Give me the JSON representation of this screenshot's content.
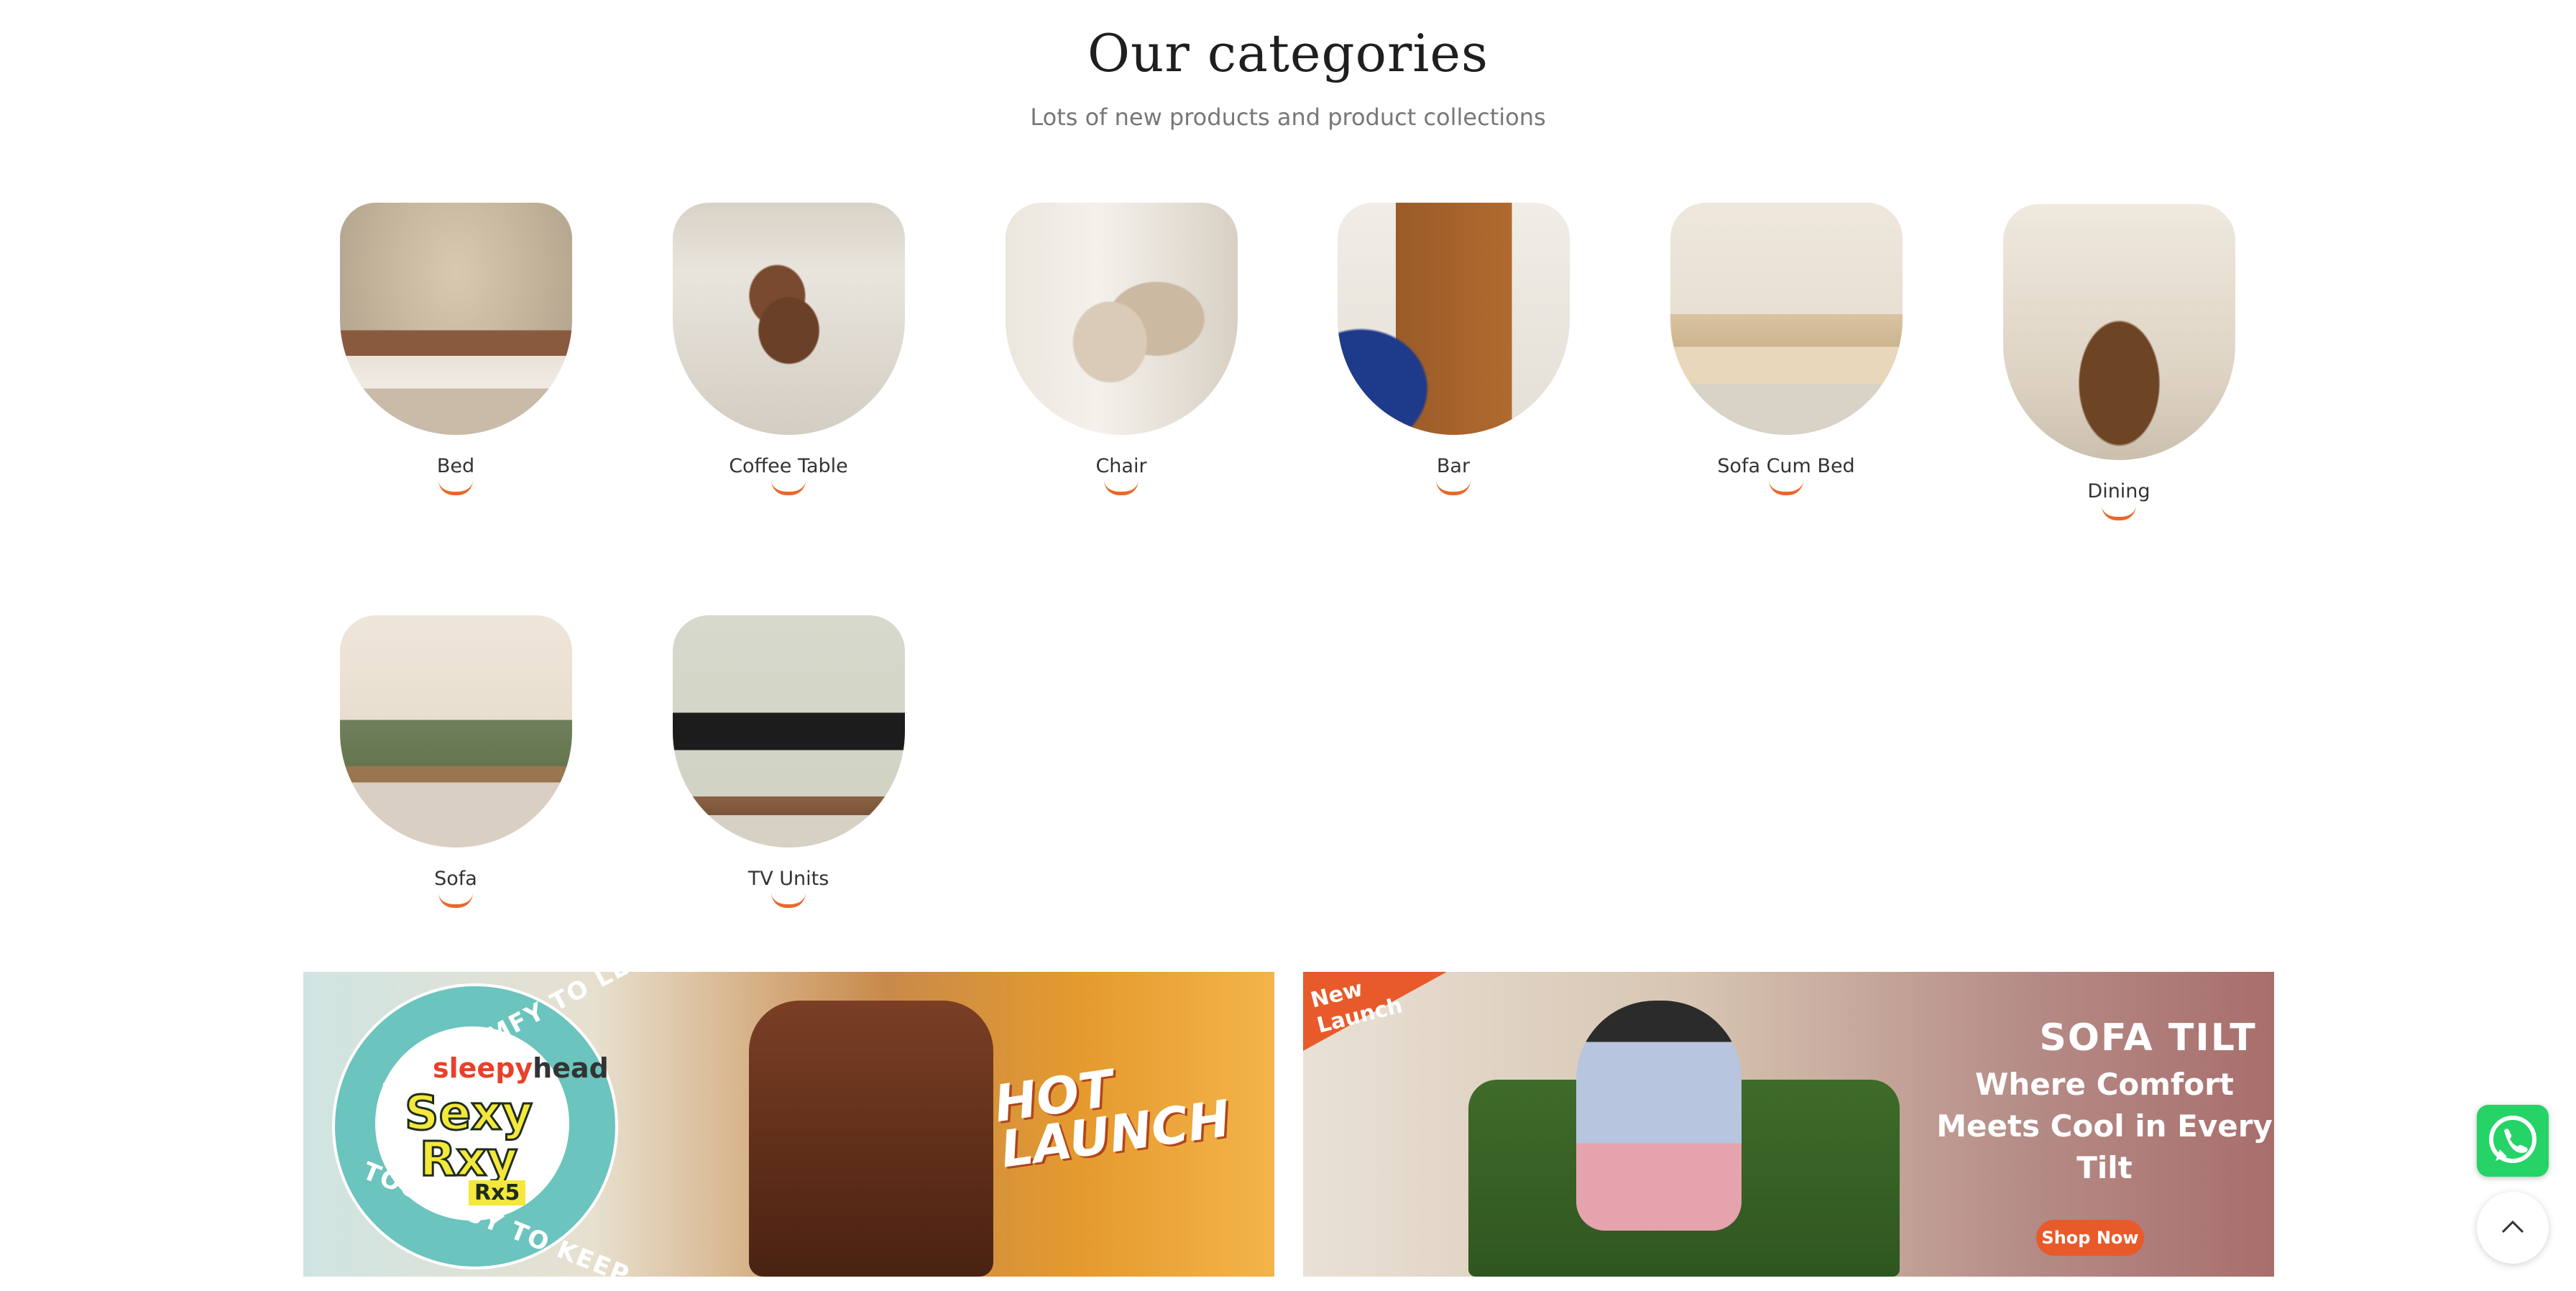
{
  "section": {
    "title": "Our categories",
    "subtitle": "Lots of new products and product collections"
  },
  "categories": [
    {
      "label": "Bed"
    },
    {
      "label": "Coffee Table"
    },
    {
      "label": "Chair"
    },
    {
      "label": "Bar"
    },
    {
      "label": "Sofa Cum Bed"
    },
    {
      "label": "Dining"
    },
    {
      "label": "Sofa"
    },
    {
      "label": "TV Units"
    }
  ],
  "banners": {
    "left": {
      "ring_text_top": "TOO COMFY TO LEAVE",
      "ring_text_bottom": "TOO EASY TO KEEP",
      "brand_part1": "sleepy",
      "brand_part2": "head",
      "product_line1": "Sexy",
      "product_line2": "Rxy",
      "model": "Rx5",
      "headline_line1": "HOT",
      "headline_line2": "LAUNCH"
    },
    "right": {
      "badge_line1": "New",
      "badge_line2": "Launch",
      "title": "SOFA TILT",
      "subtitle": "Where Comfort Meets Cool in Every Tilt",
      "cta": "Shop Now"
    }
  },
  "floating": {
    "whatsapp_icon": "whatsapp-icon",
    "scroll_top_icon": "chevron-up-icon"
  },
  "colors": {
    "accent": "#e8682a",
    "whatsapp": "#25d366"
  }
}
